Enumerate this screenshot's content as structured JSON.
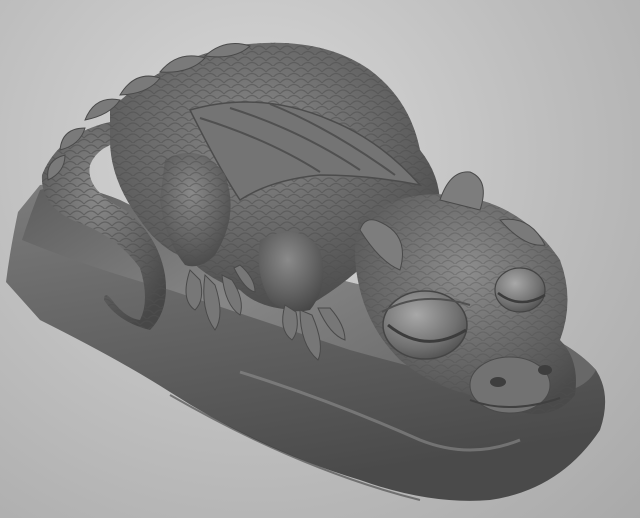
{
  "scene": {
    "subject": "dragon-sculpture-icon",
    "background_color": "#c4c4c4",
    "model_color": "#6e6e6e"
  }
}
